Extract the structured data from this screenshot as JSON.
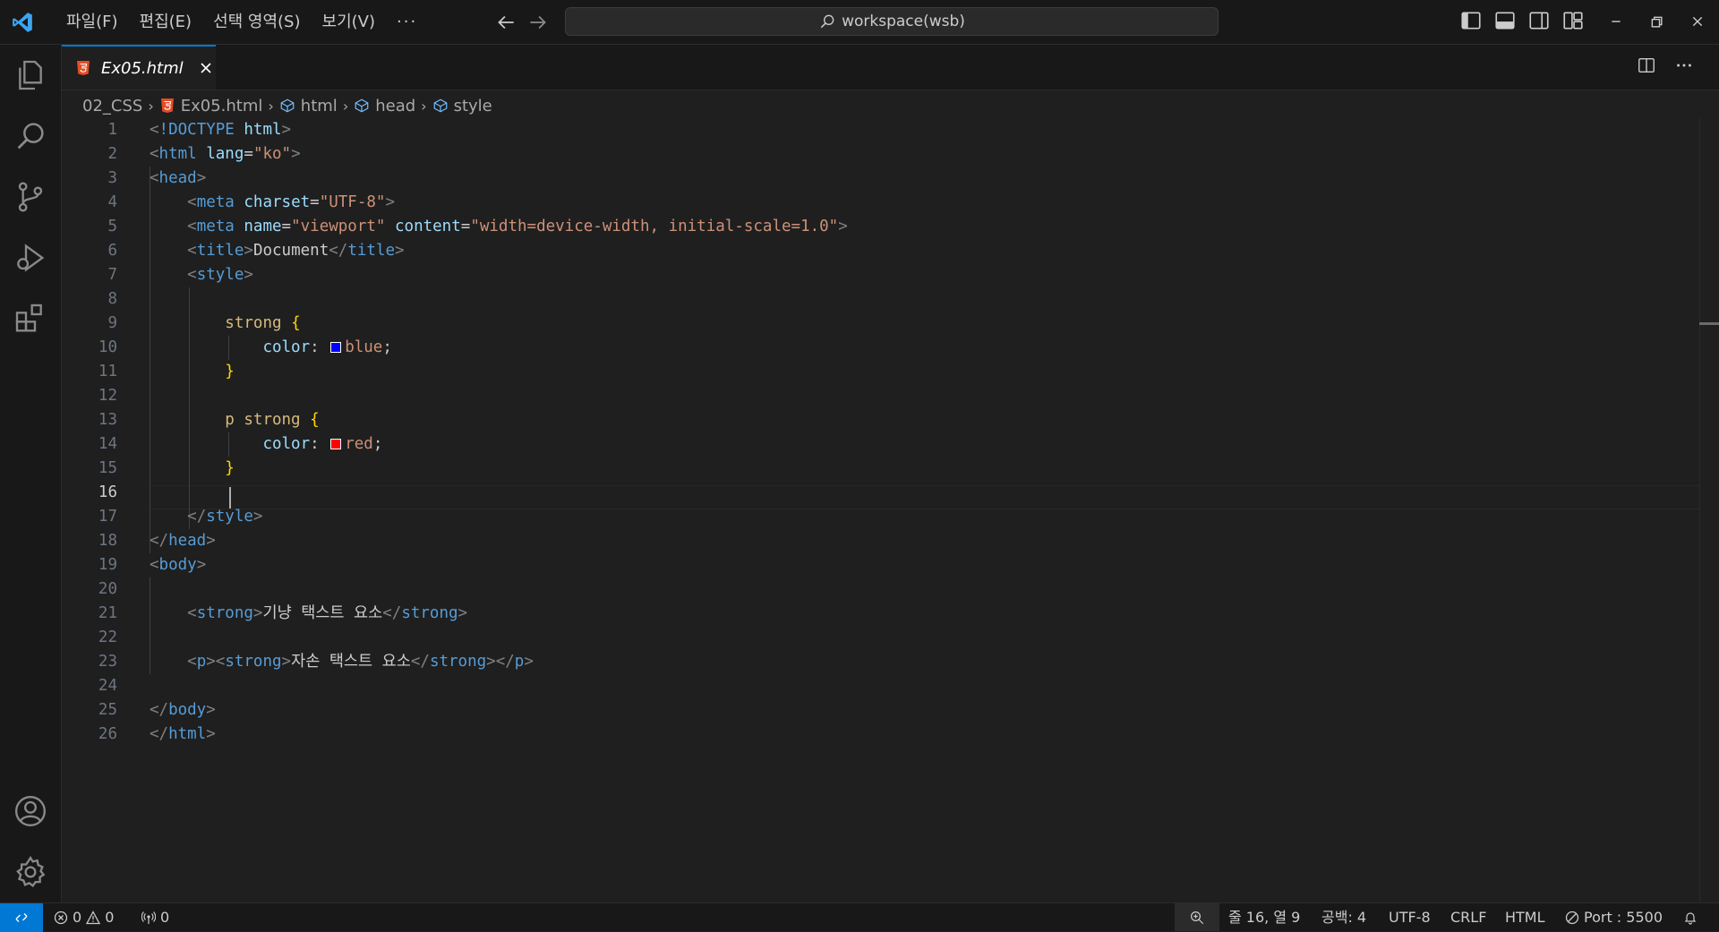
{
  "titlebar": {
    "menu": [
      "파일(F)",
      "편집(E)",
      "선택 영역(S)",
      "보기(V)"
    ],
    "more": "···",
    "search_text": "workspace(wsb)"
  },
  "tab": {
    "label": "Ex05.html"
  },
  "breadcrumb": [
    "02_CSS",
    "Ex05.html",
    "html",
    "head",
    "style"
  ],
  "editor": {
    "current_line": 16,
    "lines": [
      {
        "n": "1",
        "tokens": [
          {
            "c": "t-br",
            "t": "<"
          },
          {
            "c": "t-tag",
            "t": "!DOCTYPE "
          },
          {
            "c": "t-attr",
            "t": "html"
          },
          {
            "c": "t-br",
            "t": ">"
          }
        ]
      },
      {
        "n": "2",
        "tokens": [
          {
            "c": "t-br",
            "t": "<"
          },
          {
            "c": "t-tag",
            "t": "html "
          },
          {
            "c": "t-attr",
            "t": "lang"
          },
          {
            "c": "t-txt",
            "t": "="
          },
          {
            "c": "t-str",
            "t": "\"ko\""
          },
          {
            "c": "t-br",
            "t": ">"
          }
        ]
      },
      {
        "n": "3",
        "tokens": [
          {
            "c": "t-br",
            "t": "<"
          },
          {
            "c": "t-tag",
            "t": "head"
          },
          {
            "c": "t-br",
            "t": ">"
          }
        ]
      },
      {
        "n": "4",
        "tokens": [
          {
            "c": "t-txt",
            "t": "    "
          },
          {
            "c": "t-br",
            "t": "<"
          },
          {
            "c": "t-tag",
            "t": "meta "
          },
          {
            "c": "t-attr",
            "t": "charset"
          },
          {
            "c": "t-txt",
            "t": "="
          },
          {
            "c": "t-str",
            "t": "\"UTF-8\""
          },
          {
            "c": "t-br",
            "t": ">"
          }
        ]
      },
      {
        "n": "5",
        "tokens": [
          {
            "c": "t-txt",
            "t": "    "
          },
          {
            "c": "t-br",
            "t": "<"
          },
          {
            "c": "t-tag",
            "t": "meta "
          },
          {
            "c": "t-attr",
            "t": "name"
          },
          {
            "c": "t-txt",
            "t": "="
          },
          {
            "c": "t-str",
            "t": "\"viewport\" "
          },
          {
            "c": "t-attr",
            "t": "content"
          },
          {
            "c": "t-txt",
            "t": "="
          },
          {
            "c": "t-str",
            "t": "\"width=device-width, initial-scale=1.0\""
          },
          {
            "c": "t-br",
            "t": ">"
          }
        ]
      },
      {
        "n": "6",
        "tokens": [
          {
            "c": "t-txt",
            "t": "    "
          },
          {
            "c": "t-br",
            "t": "<"
          },
          {
            "c": "t-tag",
            "t": "title"
          },
          {
            "c": "t-br",
            "t": ">"
          },
          {
            "c": "t-txt",
            "t": "Document"
          },
          {
            "c": "t-br",
            "t": "</"
          },
          {
            "c": "t-tag",
            "t": "title"
          },
          {
            "c": "t-br",
            "t": ">"
          }
        ]
      },
      {
        "n": "7",
        "tokens": [
          {
            "c": "t-txt",
            "t": "    "
          },
          {
            "c": "t-br",
            "t": "<"
          },
          {
            "c": "t-tag",
            "t": "style"
          },
          {
            "c": "t-br",
            "t": ">"
          }
        ]
      },
      {
        "n": "8",
        "tokens": []
      },
      {
        "n": "9",
        "tokens": [
          {
            "c": "t-txt",
            "t": "        "
          },
          {
            "c": "t-sel",
            "t": "strong "
          },
          {
            "c": "t-brace",
            "t": "{"
          }
        ]
      },
      {
        "n": "10",
        "tokens": [
          {
            "c": "t-txt",
            "t": "            "
          },
          {
            "c": "t-prop",
            "t": "color"
          },
          {
            "c": "t-txt",
            "t": ": "
          },
          {
            "swatch": "#0000ff"
          },
          {
            "c": "t-val",
            "t": "blue"
          },
          {
            "c": "t-txt",
            "t": ";"
          }
        ]
      },
      {
        "n": "11",
        "tokens": [
          {
            "c": "t-txt",
            "t": "        "
          },
          {
            "c": "t-brace",
            "t": "}"
          }
        ]
      },
      {
        "n": "12",
        "tokens": []
      },
      {
        "n": "13",
        "tokens": [
          {
            "c": "t-txt",
            "t": "        "
          },
          {
            "c": "t-sel",
            "t": "p strong "
          },
          {
            "c": "t-brace",
            "t": "{"
          }
        ]
      },
      {
        "n": "14",
        "tokens": [
          {
            "c": "t-txt",
            "t": "            "
          },
          {
            "c": "t-prop",
            "t": "color"
          },
          {
            "c": "t-txt",
            "t": ": "
          },
          {
            "swatch": "#ff0000"
          },
          {
            "c": "t-val",
            "t": "red"
          },
          {
            "c": "t-txt",
            "t": ";"
          }
        ]
      },
      {
        "n": "15",
        "tokens": [
          {
            "c": "t-txt",
            "t": "        "
          },
          {
            "c": "t-brace",
            "t": "}"
          }
        ]
      },
      {
        "n": "16",
        "tokens": []
      },
      {
        "n": "17",
        "tokens": [
          {
            "c": "t-txt",
            "t": "    "
          },
          {
            "c": "t-br",
            "t": "</"
          },
          {
            "c": "t-tag",
            "t": "style"
          },
          {
            "c": "t-br",
            "t": ">"
          }
        ]
      },
      {
        "n": "18",
        "tokens": [
          {
            "c": "t-br",
            "t": "</"
          },
          {
            "c": "t-tag",
            "t": "head"
          },
          {
            "c": "t-br",
            "t": ">"
          }
        ]
      },
      {
        "n": "19",
        "tokens": [
          {
            "c": "t-br",
            "t": "<"
          },
          {
            "c": "t-tag",
            "t": "body"
          },
          {
            "c": "t-br",
            "t": ">"
          }
        ]
      },
      {
        "n": "20",
        "tokens": []
      },
      {
        "n": "21",
        "tokens": [
          {
            "c": "t-txt",
            "t": "    "
          },
          {
            "c": "t-br",
            "t": "<"
          },
          {
            "c": "t-tag",
            "t": "strong"
          },
          {
            "c": "t-br",
            "t": ">"
          },
          {
            "c": "t-txt",
            "t": "기냥 택스트 요소"
          },
          {
            "c": "t-br",
            "t": "</"
          },
          {
            "c": "t-tag",
            "t": "strong"
          },
          {
            "c": "t-br",
            "t": ">"
          }
        ]
      },
      {
        "n": "22",
        "tokens": []
      },
      {
        "n": "23",
        "tokens": [
          {
            "c": "t-txt",
            "t": "    "
          },
          {
            "c": "t-br",
            "t": "<"
          },
          {
            "c": "t-tag",
            "t": "p"
          },
          {
            "c": "t-br",
            "t": "><"
          },
          {
            "c": "t-tag",
            "t": "strong"
          },
          {
            "c": "t-br",
            "t": ">"
          },
          {
            "c": "t-txt",
            "t": "자손 택스트 요소"
          },
          {
            "c": "t-br",
            "t": "</"
          },
          {
            "c": "t-tag",
            "t": "strong"
          },
          {
            "c": "t-br",
            "t": "></"
          },
          {
            "c": "t-tag",
            "t": "p"
          },
          {
            "c": "t-br",
            "t": ">"
          }
        ]
      },
      {
        "n": "24",
        "tokens": []
      },
      {
        "n": "25",
        "tokens": [
          {
            "c": "t-br",
            "t": "</"
          },
          {
            "c": "t-tag",
            "t": "body"
          },
          {
            "c": "t-br",
            "t": ">"
          }
        ]
      },
      {
        "n": "26",
        "tokens": [
          {
            "c": "t-br",
            "t": "</"
          },
          {
            "c": "t-tag",
            "t": "html"
          },
          {
            "c": "t-br",
            "t": ">"
          }
        ]
      }
    ]
  },
  "statusbar": {
    "errors": "0",
    "warnings": "0",
    "ports": "0",
    "position": "줄 16, 열 9",
    "spaces": "공백: 4",
    "encoding": "UTF-8",
    "eol": "CRLF",
    "language": "HTML",
    "port": "Port : 5500"
  },
  "colors": {
    "accent": "#0078d4",
    "background": "#1f1f1f",
    "html_icon": "#e44d26"
  }
}
